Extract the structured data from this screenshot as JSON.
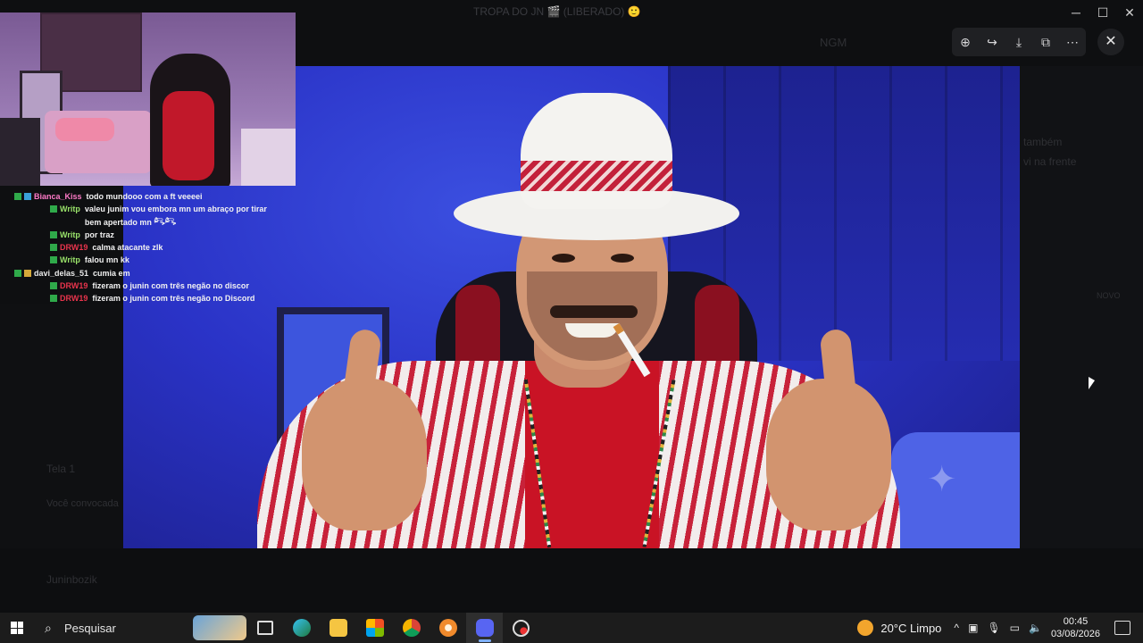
{
  "background": {
    "window_title": "TROPA DO JN 🎬 (LIBERADO) 🙂",
    "faded_texts": [
      "NGM",
      "também",
      "vi na frente",
      "Tela 1",
      "Você convocada",
      "Juninbozik",
      "NOVO"
    ]
  },
  "window_controls": {
    "minimize": "─",
    "maximize": "☐",
    "close": "✕"
  },
  "chat": {
    "messages": [
      {
        "user": "Bianca_Kiss",
        "color": "#ff7bc8",
        "text": "todo mundooo com a ft veeeei",
        "badges": [
          "b-green",
          "b-blue"
        ],
        "indent": 0
      },
      {
        "user": "Writp",
        "color": "#9ae36a",
        "text": "valeu junim vou embora mn um abraço por tirar bem apertado mn 𓀐𓀐",
        "badges": [
          "b-green"
        ],
        "indent": 1
      },
      {
        "user": "Writp",
        "color": "#9ae36a",
        "text": "por traz",
        "badges": [
          "b-green"
        ],
        "indent": 1
      },
      {
        "user": "DRW19",
        "color": "#e8344c",
        "text": "calma atacante zlk",
        "badges": [
          "b-green"
        ],
        "indent": 1
      },
      {
        "user": "Writp",
        "color": "#9ae36a",
        "text": "falou mn kk",
        "badges": [
          "b-green"
        ],
        "indent": 1
      },
      {
        "user": "davi_delas_51",
        "color": "#e9e9e9",
        "text": "cumia em",
        "badges": [
          "b-green",
          "b-gold"
        ],
        "indent": 0
      },
      {
        "user": "DRW19",
        "color": "#e8344c",
        "text": "fizeram o junin com três negão no discor",
        "badges": [
          "b-green"
        ],
        "indent": 1
      },
      {
        "user": "DRW19",
        "color": "#e8344c",
        "text": "fizeram o junin com três negão no Discord",
        "badges": [
          "b-green"
        ],
        "indent": 1
      }
    ]
  },
  "viewer_toolbar": {
    "zoom": "⊕",
    "forward": "↪",
    "download": "⤓",
    "open_external": "⧉",
    "more": "⋯",
    "close": "✕"
  },
  "taskbar": {
    "search_placeholder": "Pesquisar",
    "weather": "20°C  Limpo",
    "time": "00:45",
    "date": "03/08/2026",
    "tray_chevron": "^",
    "icons": [
      "task-view-icon",
      "edge-icon",
      "file-explorer-icon",
      "store-icon",
      "chrome-icon",
      "orange-app-icon",
      "discord-icon",
      "clock-app-icon"
    ]
  }
}
